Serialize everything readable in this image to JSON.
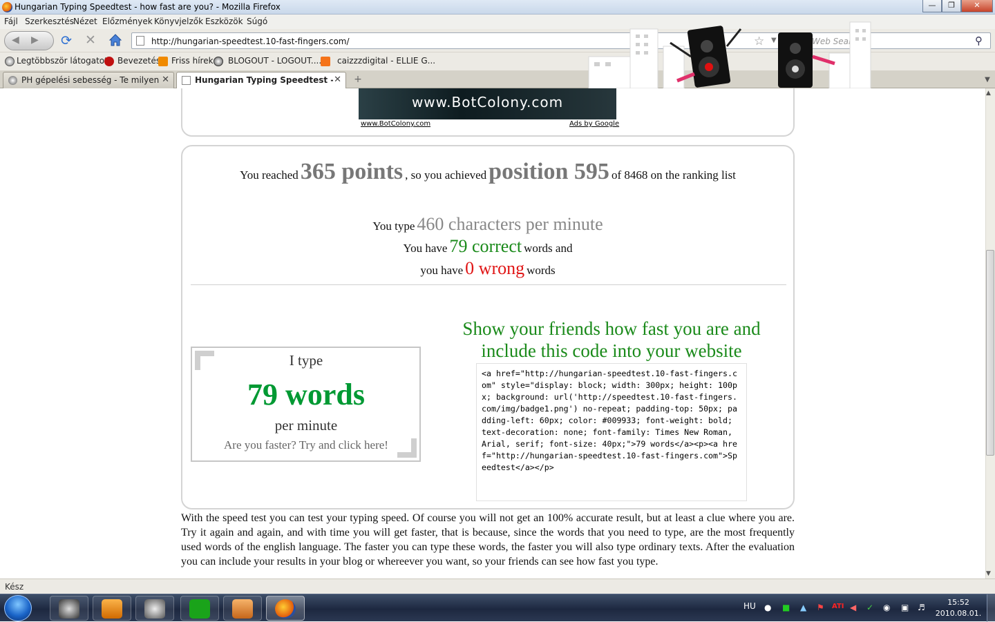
{
  "window": {
    "title": "Hungarian Typing Speedtest - how fast are you? - Mozilla Firefox"
  },
  "menu": [
    "Fájl",
    "Szerkesztés",
    "Nézet",
    "Előzmények",
    "Könyvjelzők",
    "Eszközök",
    "Súgó"
  ],
  "nav": {
    "url": "http://hungarian-speedtest.10-fast-fingers.com/",
    "search_placeholder": "Web Search..."
  },
  "bookmarks": [
    "Legtöbbször látogatott",
    "Bevezetés",
    "Friss hírek",
    "BLOGOUT - LOGOUT....",
    "caizzzdigital - ELLIE G..."
  ],
  "tabs": [
    {
      "label": "PH gépelési sebesség - Te milyen g...",
      "active": false
    },
    {
      "label": "Hungarian Typing Speedtest - ho...",
      "active": true
    }
  ],
  "ad": {
    "banner": "www.BotColony.com",
    "link": "www.BotColony.com",
    "ads_by": "Ads by Google"
  },
  "result": {
    "reached_pre": "You reached",
    "points": "365 points",
    "achieved": ", so you achieved",
    "position": "position 595",
    "of_total": "of 8468 on the ranking list",
    "type_pre": "You type",
    "cpm": "460 characters per minute",
    "have_pre": "You have",
    "correct": "79 correct",
    "words_and": "words and",
    "have_pre2": "you have",
    "wrong": "0 wrong",
    "words": "words"
  },
  "badge": {
    "line1": "I type",
    "words": "79 words",
    "per_minute": "per minute",
    "cta": "Are you faster? Try and click here!"
  },
  "share": {
    "heading": "Show your friends how fast you are and include this code into your website",
    "code": "<a href=\"http://hungarian-speedtest.10-fast-fingers.com\" style=\"display: block; width: 300px; height: 100px; background: url('http://speedtest.10-fast-fingers.com/img/badge1.png') no-repeat; padding-top: 50px; padding-left: 60px; color: #009933; font-weight: bold; text-decoration: none; font-family: Times New Roman, Arial, serif; font-size: 40px;\">79 words</a><p><a href=\"http://hungarian-speedtest.10-fast-fingers.com\">Speedtest</a></p>"
  },
  "description": "With the speed test you can test your typing speed. Of course you will not get an 100% accurate result, but at least a clue where you are. Try it again and again, and with time you will get faster, that is because, since the words that you need to type, are the most frequently used words of the english language. The faster you can type these words, the faster you will also type ordinary texts. After the evaluation you can include your results in your blog or whereever you want, so your friends can see how fast you type.",
  "status": "Kész",
  "taskbar": {
    "lang": "HU",
    "time": "15:52",
    "date": "2010.08.01."
  },
  "colors": {
    "correct": "#1a8a1a",
    "wrong": "#e01515",
    "badge_green": "#009933"
  }
}
